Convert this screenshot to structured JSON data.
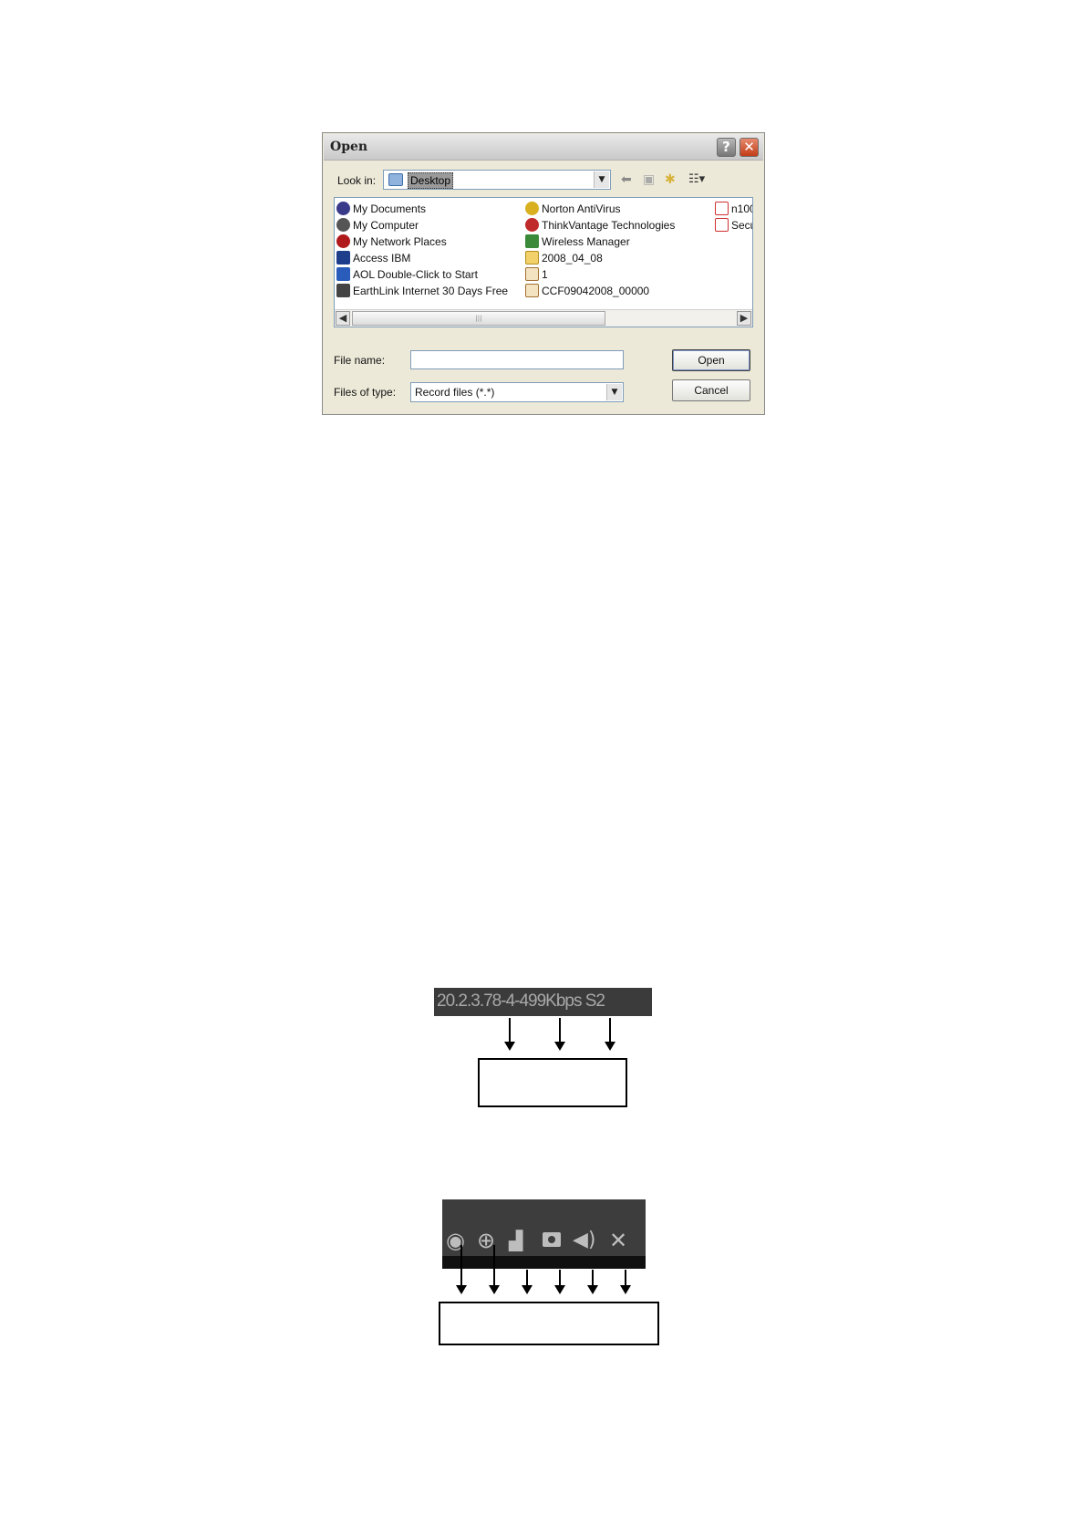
{
  "dialog": {
    "title": "Open",
    "help_button": "?",
    "close_button": "✕",
    "look_in_label": "Look in:",
    "look_in_value": "Desktop",
    "items": [
      "My Documents",
      "My Computer",
      "My Network Places",
      "Access IBM",
      "AOL Double-Click to Start",
      "EarthLink Internet 30 Days Free",
      "Norton AntiVirus",
      "ThinkVantage Technologies",
      "Wireless Manager",
      "2008_04_08",
      "1",
      "CCF09042008_00000",
      "n100",
      "Secu"
    ],
    "file_name_label": "File name:",
    "file_name_value": "",
    "files_of_type_label": "Files of type:",
    "files_of_type_value": "Record files (*.*)",
    "open_button": "Open",
    "cancel_button": "Cancel"
  },
  "stream_info": {
    "text": "20.2.3.78-4-499Kbps S2"
  },
  "colors": {
    "dialog_bg": "#ece9d8",
    "bar_bg": "#3b3b3b",
    "bar_text": "#a8a8a8"
  },
  "toolbar_icons": [
    "eye-icon",
    "zoom-in-icon",
    "video-record-icon",
    "snapshot-camera-icon",
    "speaker-icon",
    "close-icon"
  ]
}
